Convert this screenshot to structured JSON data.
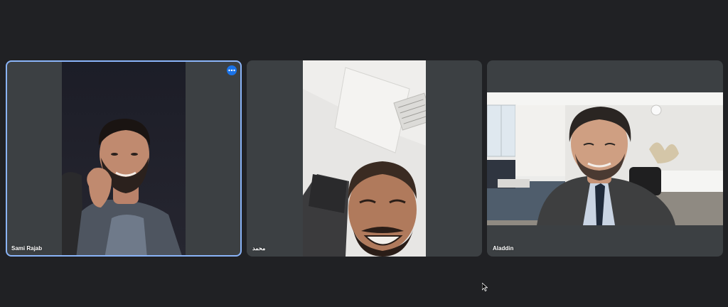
{
  "participants": [
    {
      "name": "Sami Rajab",
      "active_speaker": true,
      "more_options_icon": "more-horizontal-icon"
    },
    {
      "name": "محمد",
      "active_speaker": false
    },
    {
      "name": "Aladdin",
      "active_speaker": false
    }
  ],
  "colors": {
    "background": "#202124",
    "tile": "#3c4043",
    "active_border": "#8ab4f8",
    "accent": "#1a73e8"
  }
}
